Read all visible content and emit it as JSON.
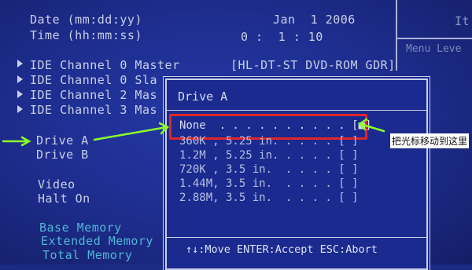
{
  "info": {
    "date_label": "Date (mm:dd:yy)",
    "time_label": "Time (hh:mm:ss)",
    "date_value": "Jan  1 2006",
    "time_value": "0 :  1 : 10"
  },
  "right_panel": {
    "item_label": "It",
    "menu_level_label": "Menu Leve"
  },
  "menu": {
    "ide_items": [
      {
        "label": "IDE Channel 0 Master"
      },
      {
        "label": "IDE Channel 0 Sla"
      },
      {
        "label": "IDE Channel 2 Mas"
      },
      {
        "label": "IDE Channel 3 Mas"
      }
    ],
    "ide0_master_value": "[HL-DT-ST DVD-ROM GDR]",
    "drive_a": "Drive A",
    "drive_b": "Drive B",
    "video": "Video",
    "halt_on": "Halt On",
    "base_memory": "Base Memory",
    "extended_memory": "Extended Memory",
    "total_memory": "Total Memory"
  },
  "popup": {
    "title": "Drive A",
    "options": [
      {
        "label": "None  . . . . . . . . . . [■]"
      },
      {
        "label": "360K , 5.25 in. . . . . [ ]"
      },
      {
        "label": "1.2M , 5.25 in. . . . . [ ]"
      },
      {
        "label": "720K , 3.5 in.  . . . . [ ]"
      },
      {
        "label": "1.44M, 3.5 in.  . . . . [ ]"
      },
      {
        "label": "2.88M, 3.5 in.  . . . . [ ]"
      }
    ],
    "help": "↑↓:Move ENTER:Accept ESC:Abort"
  },
  "annotation": {
    "text": "把光标移动到这里",
    "arrow_color": "#8cff2a",
    "box_color": "#e02628"
  }
}
